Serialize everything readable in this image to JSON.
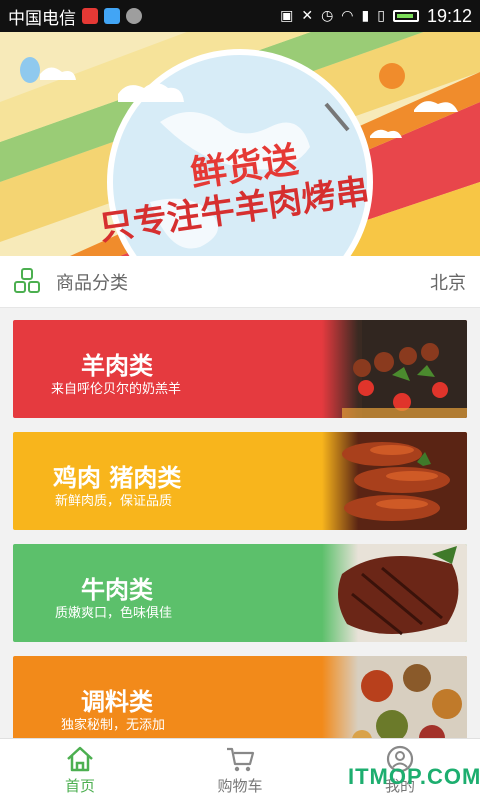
{
  "statusbar": {
    "carrier": "中国电信",
    "time": "19:12"
  },
  "banner": {
    "title_line1": "鲜货送",
    "title_line2": "只专注牛羊肉烤串"
  },
  "categories_header": {
    "label": "商品分类",
    "city": "北京"
  },
  "cards": [
    {
      "title": "羊肉类",
      "subtitle": "来自呼伦贝尔的奶羔羊",
      "color": "#e53a3f"
    },
    {
      "title": "鸡肉  猪肉类",
      "subtitle": "新鲜肉质，保证品质",
      "color": "#f8b51c"
    },
    {
      "title": "牛肉类",
      "subtitle": "质嫩爽口，色味俱佳",
      "color": "#5cc06b"
    },
    {
      "title": "调料类",
      "subtitle": "独家秘制，无添加",
      "color": "#f28a1a"
    }
  ],
  "tabbar": {
    "home": "首页",
    "cart": "购物车",
    "mine": "我的"
  },
  "watermark": "ITMOP.COM"
}
